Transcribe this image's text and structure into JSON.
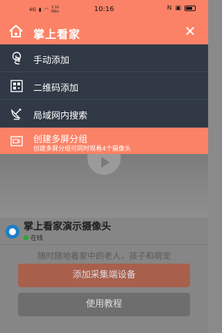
{
  "status_bar": {
    "network": "4G",
    "speed_value": "3.10",
    "speed_unit": "KB/s",
    "time": "10:16"
  },
  "header": {
    "title": "掌上看家",
    "close_symbol": "✕"
  },
  "menu": {
    "items": [
      {
        "label": "手动添加",
        "icon": "hand-pointer-icon"
      },
      {
        "label": "二维码添加",
        "icon": "qr-code-icon"
      },
      {
        "label": "局域网内搜索",
        "icon": "satellite-dish-icon"
      },
      {
        "label": "创建多屏分组",
        "subtitle": "创建多屏分组可同时观看4个摄像头",
        "icon": "multi-screen-icon",
        "highlighted": true
      }
    ]
  },
  "camera": {
    "name": "掌上看家演示摄像头",
    "status": "在线"
  },
  "info": {
    "description": "随时随地看家中的老人，孩子和萌宠"
  },
  "buttons": {
    "add_device": "添加采集端设备",
    "tutorial": "使用教程"
  },
  "colors": {
    "accent": "#fb8266",
    "menu_bg": "#303945",
    "online": "#2fa52f"
  }
}
